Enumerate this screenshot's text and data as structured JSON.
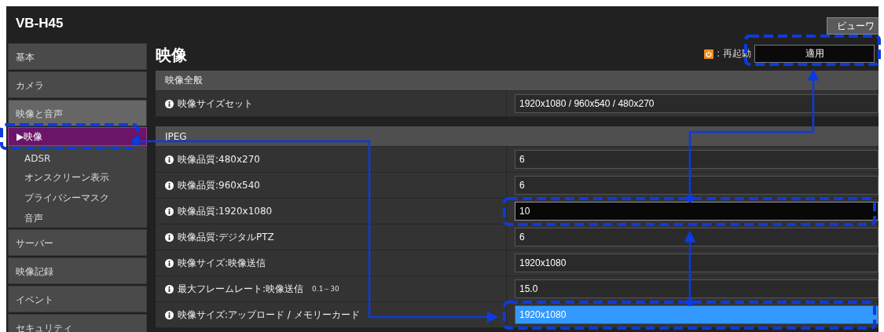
{
  "app": {
    "model": "VB-H45",
    "viewer_button": "ビューワ"
  },
  "sidebar": {
    "marker": "▶",
    "items": [
      {
        "label": "基本",
        "expanded": false
      },
      {
        "label": "カメラ",
        "expanded": false
      },
      {
        "label": "映像と音声",
        "expanded": true,
        "children": [
          {
            "label": "映像",
            "selected": true
          },
          {
            "label": "ADSR",
            "selected": false
          },
          {
            "label": "オンスクリーン表示",
            "selected": false
          },
          {
            "label": "プライバシーマスク",
            "selected": false
          },
          {
            "label": "音声",
            "selected": false
          }
        ]
      },
      {
        "label": "サーバー",
        "expanded": false
      },
      {
        "label": "映像記録",
        "expanded": false
      },
      {
        "label": "イベント",
        "expanded": false
      },
      {
        "label": "セキュリティ",
        "expanded": false
      }
    ]
  },
  "page": {
    "title": "映像",
    "restart_legend": ": 再起動",
    "apply_button": "適用"
  },
  "sections": [
    {
      "title": "映像全般",
      "rows": [
        {
          "label": "映像サイズセット",
          "value": "1920x1080 / 960x540 / 480x270",
          "focused": false,
          "highlighted": false
        }
      ]
    },
    {
      "title": "JPEG",
      "rows": [
        {
          "label": "映像品質:480x270",
          "value": "6",
          "focused": false,
          "highlighted": false
        },
        {
          "label": "映像品質:960x540",
          "value": "6",
          "focused": false,
          "highlighted": false
        },
        {
          "label": "映像品質:1920x1080",
          "value": "10",
          "focused": true,
          "highlighted": false
        },
        {
          "label": "映像品質:デジタルPTZ",
          "value": "6",
          "focused": false,
          "highlighted": false
        },
        {
          "label": "映像サイズ:映像送信",
          "value": "1920x1080",
          "focused": false,
          "highlighted": false
        },
        {
          "label": "最大フレームレート:映像送信",
          "hint": "0.1～30",
          "value": "15.0",
          "focused": false,
          "highlighted": false
        },
        {
          "label": "映像サイズ:アップロード / メモリーカード",
          "value": "1920x1080",
          "focused": false,
          "highlighted": true
        }
      ]
    }
  ]
}
